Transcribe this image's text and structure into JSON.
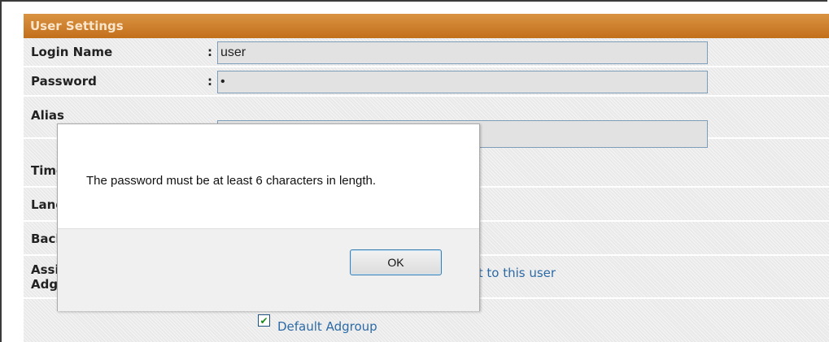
{
  "settings": {
    "title": "User Settings",
    "rows": [
      {
        "label": "Login Name",
        "colon": ":",
        "value": "user"
      },
      {
        "label": "Password",
        "colon": ":",
        "value": "•"
      },
      {
        "label": "Alias",
        "colon": ":",
        "value": ""
      },
      {
        "label": "Time Zone",
        "colon": ":",
        "value": ""
      },
      {
        "label": "Language",
        "colon": ":",
        "value": ""
      },
      {
        "label": "Background",
        "colon": ":",
        "value": ""
      }
    ],
    "assign_label": "Assign Adgroup",
    "assign_text": "ent to this user",
    "default_adgroup_label": "Default Adgroup",
    "default_adgroup_checked": true
  },
  "dialog": {
    "message": "The password must be at least 6 characters in length.",
    "ok_label": "OK"
  },
  "colors": {
    "header": "#c87a26",
    "panel": "#e9e9e9",
    "link_text": "#2c6aa6"
  }
}
